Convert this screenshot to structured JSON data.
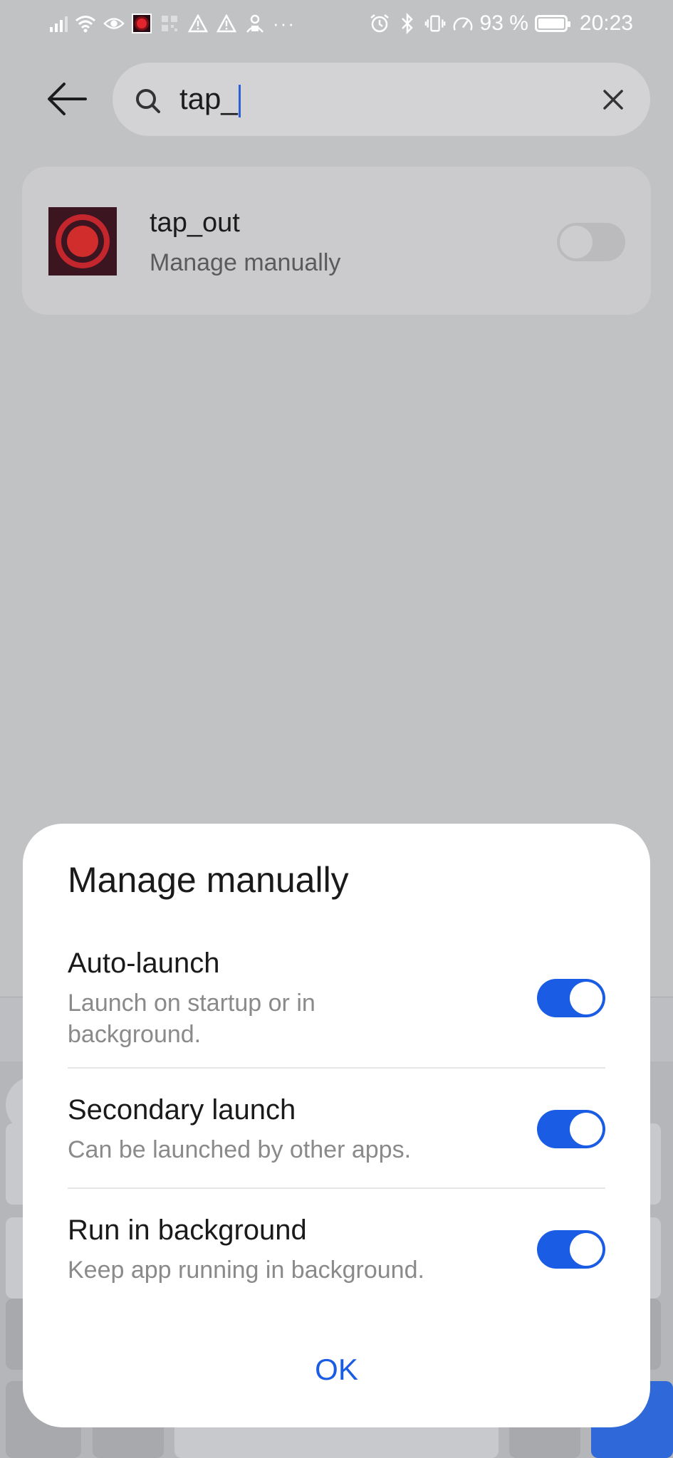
{
  "status_bar": {
    "battery_percent": "93 %",
    "time": "20:23",
    "dots": "···"
  },
  "search": {
    "query": "tap_"
  },
  "result": {
    "app_name": "tap_out",
    "subtitle": "Manage manually",
    "toggle_on": false
  },
  "dialog": {
    "title": "Manage manually",
    "options": [
      {
        "title": "Auto-launch",
        "description": "Launch on startup or in background.",
        "enabled": true
      },
      {
        "title": "Secondary launch",
        "description": "Can be launched by other apps.",
        "enabled": true
      },
      {
        "title": "Run in background",
        "description": "Keep app running in background.",
        "enabled": true
      }
    ],
    "ok_label": "OK"
  },
  "colors": {
    "accent": "#1a5ce3",
    "scrim_background": "#c1c2c4",
    "app_icon_red": "#d22d2d"
  }
}
